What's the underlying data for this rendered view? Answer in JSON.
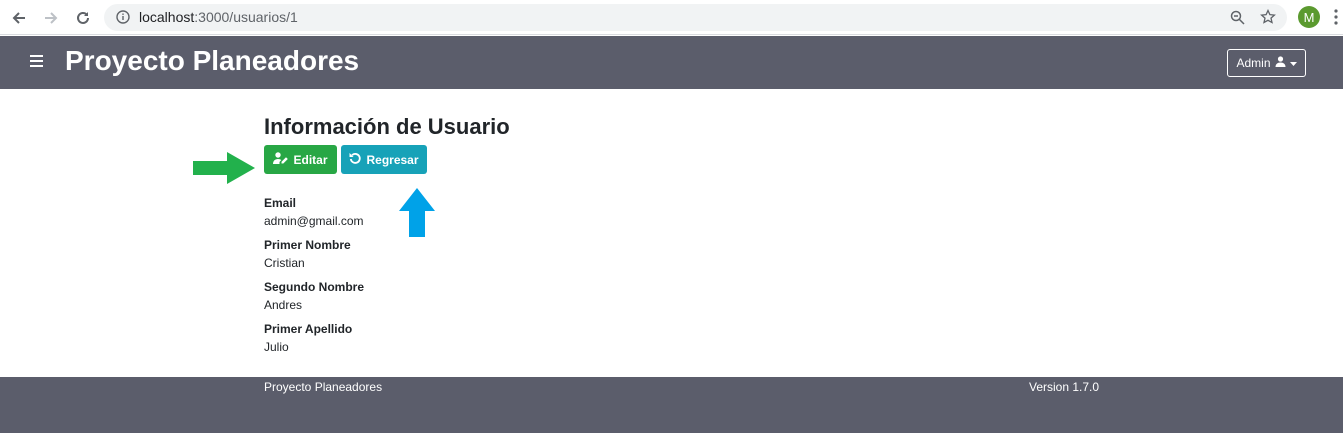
{
  "browser": {
    "url_host": "localhost",
    "url_path": ":3000/usuarios/1",
    "profile_initial": "M"
  },
  "navbar": {
    "brand": "Proyecto Planeadores",
    "admin_label": "Admin"
  },
  "main": {
    "title": "Información de Usuario",
    "edit_label": "Editar",
    "back_label": "Regresar",
    "fields": [
      {
        "label": "Email",
        "value": "admin@gmail.com"
      },
      {
        "label": "Primer Nombre",
        "value": "Cristian"
      },
      {
        "label": "Segundo Nombre",
        "value": "Andres"
      },
      {
        "label": "Primer Apellido",
        "value": "Julio"
      }
    ]
  },
  "footer": {
    "left": "Proyecto Planeadores",
    "right": "Version 1.7.0"
  },
  "colors": {
    "navbar": "#5b5d6b",
    "edit_button": "#28a745",
    "back_button": "#17a2b8",
    "green_arrow": "#22b14c",
    "blue_arrow": "#00a2e8"
  }
}
